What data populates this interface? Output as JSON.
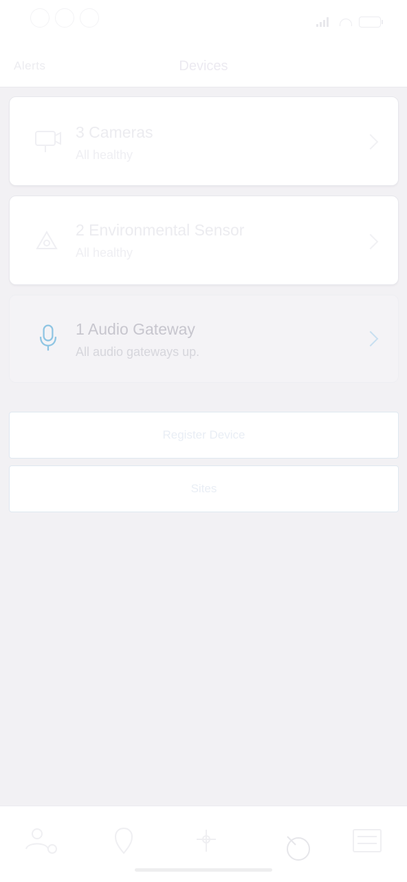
{
  "nav": {
    "back_label": "Alerts",
    "title": "Devices"
  },
  "device_cards": [
    {
      "title": "3 Cameras",
      "subtitle": "All healthy",
      "icon": "camera-icon",
      "state": "faded"
    },
    {
      "title": "2 Environmental Sensor",
      "subtitle": "All healthy",
      "icon": "sensor-icon",
      "state": "faded"
    },
    {
      "title": "1 Audio Gateway",
      "subtitle": "All audio gateways up.",
      "icon": "microphone-icon",
      "state": "highlighted"
    }
  ],
  "actions": {
    "register_label": "Register Device",
    "sites_label": "Sites"
  },
  "tabbar": {
    "tabs": [
      {
        "icon": "people-icon"
      },
      {
        "icon": "location-icon"
      },
      {
        "icon": "network-icon"
      },
      {
        "icon": "devices-icon"
      },
      {
        "icon": "list-icon"
      }
    ]
  },
  "colors": {
    "background": "#f2f1f4",
    "accent_blue": "#8fc5e3"
  }
}
